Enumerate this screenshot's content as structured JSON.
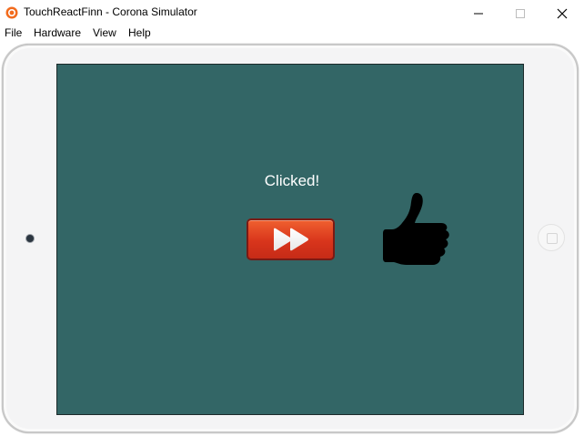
{
  "window": {
    "title": "TouchReactFinn - Corona Simulator",
    "app_icon": "corona-icon",
    "controls": [
      "minimize-icon",
      "maximize-icon",
      "close-icon"
    ]
  },
  "menu": {
    "items": [
      {
        "label": "File"
      },
      {
        "label": "Hardware"
      },
      {
        "label": "View"
      },
      {
        "label": "Help"
      }
    ]
  },
  "app": {
    "status_text": "Clicked!",
    "button_icon": "fast-forward-icon",
    "reaction_icon": "thumbs-up-icon",
    "colors": {
      "screen_background": "#336666",
      "button_red": "#d8351c",
      "text": "#ffffff"
    }
  },
  "device": {
    "type": "tablet",
    "orientation": "landscape"
  }
}
